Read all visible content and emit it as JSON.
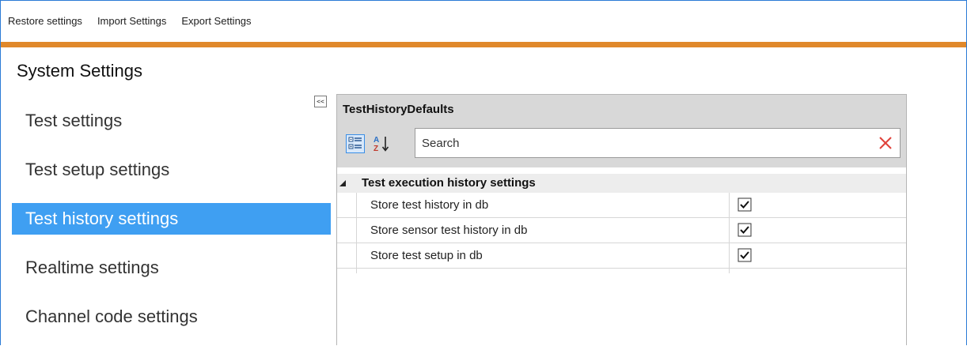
{
  "menu": {
    "restore": "Restore settings",
    "import": "Import Settings",
    "export": "Export Settings"
  },
  "page_title": "System Settings",
  "colors": {
    "accent": "#e0882b",
    "selection": "#3f9ff2",
    "header_bg": "#d8d8d8"
  },
  "nav": {
    "collapse_label": "<<",
    "items": [
      {
        "label": "Test settings",
        "selected": false
      },
      {
        "label": "Test setup settings",
        "selected": false
      },
      {
        "label": "Test history settings",
        "selected": true
      },
      {
        "label": "Realtime settings",
        "selected": false
      },
      {
        "label": "Channel code settings",
        "selected": false
      }
    ]
  },
  "property_grid": {
    "title": "TestHistoryDefaults",
    "toolbar": {
      "categorized_icon": "categorized-icon",
      "alphabetical_icon": "sort-alphabetical-icon"
    },
    "search": {
      "placeholder": "Search",
      "value": "",
      "clear_icon": "close-icon"
    },
    "categories": [
      {
        "name": "Test execution history settings",
        "expanded": true,
        "properties": [
          {
            "name": "Store test history in db",
            "value": true
          },
          {
            "name": "Store sensor test history in db",
            "value": true
          },
          {
            "name": "Store test setup in db",
            "value": true
          }
        ]
      }
    ]
  }
}
